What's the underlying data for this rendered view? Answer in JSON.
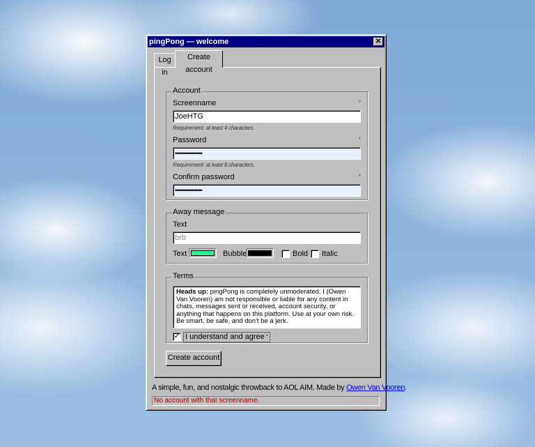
{
  "window": {
    "title": "pingPong — welcome",
    "close_glyph": "✕"
  },
  "tabs": [
    {
      "label": "Log in",
      "active": false
    },
    {
      "label": "Create account",
      "active": true
    }
  ],
  "account": {
    "legend": "Account",
    "required_mark": "*",
    "screenname": {
      "label": "Screenname",
      "value": "JoeHTG",
      "hint": "Requirement: at least 4 characters."
    },
    "password": {
      "label": "Password",
      "value": "••••••••••••••••••",
      "hint": "Requirement: at least 8 characters."
    },
    "confirm_password": {
      "label": "Confirm password",
      "value": "••••••••••••••••••"
    }
  },
  "away_message": {
    "legend": "Away message",
    "text_label": "Text",
    "text_placeholder": "brb",
    "text_color_label": "Text",
    "text_color": "#33ee99",
    "bubble_label": "Bubble",
    "bubble_color": "#000000",
    "bold_label": "Bold",
    "italic_label": "Italic"
  },
  "terms": {
    "legend": "Terms",
    "heading": "Heads up:",
    "body": " pingPong is completely unmoderated. I (Owen Van Vooren) am not responsible or liable for any content in chats, messages sent or received, account security, or anything that happens on this platform. Use at your own risk. Be smart, be safe, and don't be a jerk.",
    "agree_label": "I understand and agree",
    "agree_checked": true,
    "agree_required_mark": "*"
  },
  "create_button": "Create account",
  "footer": {
    "text": "A simple, fun, and nostalgic throwback to AOL AIM. Made by ",
    "link": "Owen Van Vooren",
    "period": "."
  },
  "status": "No account with that screenname.",
  "colors": {
    "titlebar": "#000080",
    "window": "#c0c0c0",
    "link": "#0000ee",
    "status_text": "#a00000"
  }
}
